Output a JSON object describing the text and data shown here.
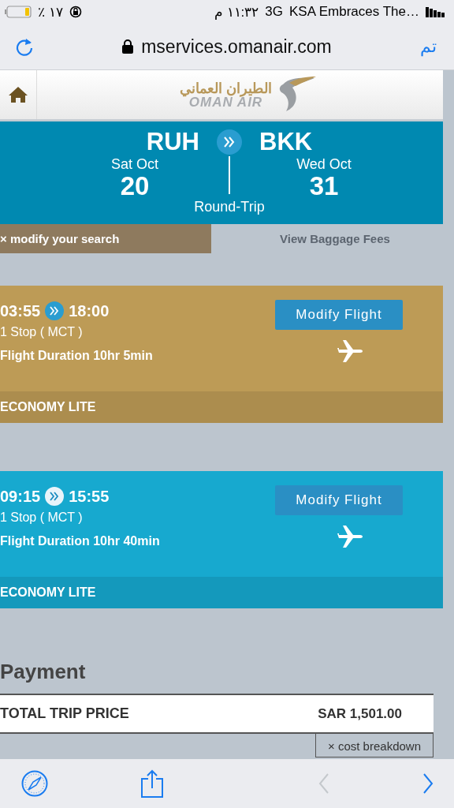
{
  "status_bar": {
    "battery": "٪ ١٧",
    "time": "١١:٣٢ م",
    "network": "3G",
    "carrier": "KSA Embraces The…"
  },
  "browser": {
    "url": "mservices.omanair.com",
    "done": "تم"
  },
  "header": {
    "logo_arabic": "الطيران العماني",
    "logo_latin": "OMAN AIR"
  },
  "search": {
    "origin": "RUH",
    "destination": "BKK",
    "depart": {
      "weekday_month": "Sat Oct",
      "day": "20"
    },
    "return": {
      "weekday_month": "Wed Oct",
      "day": "31"
    },
    "trip_type": "Round-Trip"
  },
  "actions": {
    "modify": "× modify your search",
    "baggage": "View Baggage Fees"
  },
  "flights": [
    {
      "depart": "03:55",
      "arrive": "18:00",
      "stops": "1 Stop ( MCT )",
      "duration": "Flight Duration 10hr 5min",
      "button": "Modify Flight",
      "cabin": "ECONOMY LITE",
      "color": "#bd9b56"
    },
    {
      "depart": "09:15",
      "arrive": "15:55",
      "stops": "1 Stop ( MCT )",
      "duration": "Flight Duration 10hr 40min",
      "button": "Modify Flight",
      "cabin": "ECONOMY LITE",
      "color": "#17a9cf"
    }
  ],
  "payment": {
    "title": "Payment",
    "total_label": "TOTAL TRIP PRICE",
    "total_value": "SAR 1,501.00",
    "breakdown": "× cost breakdown"
  }
}
